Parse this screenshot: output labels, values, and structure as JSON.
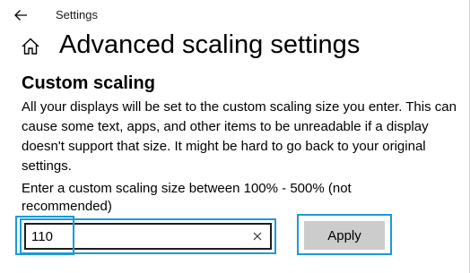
{
  "window": {
    "app_title": "Settings"
  },
  "header": {
    "page_title": "Advanced scaling settings"
  },
  "custom_scaling": {
    "section_title": "Custom scaling",
    "description": "All your displays will be set to the custom scaling size you enter. This can cause some text, apps, and other items to be unreadable if a display doesn't support that size. It might be hard to go back to your original settings.",
    "field_label": "Enter a custom scaling size between 100% - 500% (not recommended)",
    "input_value": "110",
    "apply_label": "Apply"
  },
  "colors": {
    "highlight": "#1b9ad8",
    "button_bg": "#cccccc",
    "input_border": "#1d1d1d"
  },
  "icons": {
    "back": "back-arrow-icon",
    "home": "home-icon",
    "clear": "close-icon"
  }
}
